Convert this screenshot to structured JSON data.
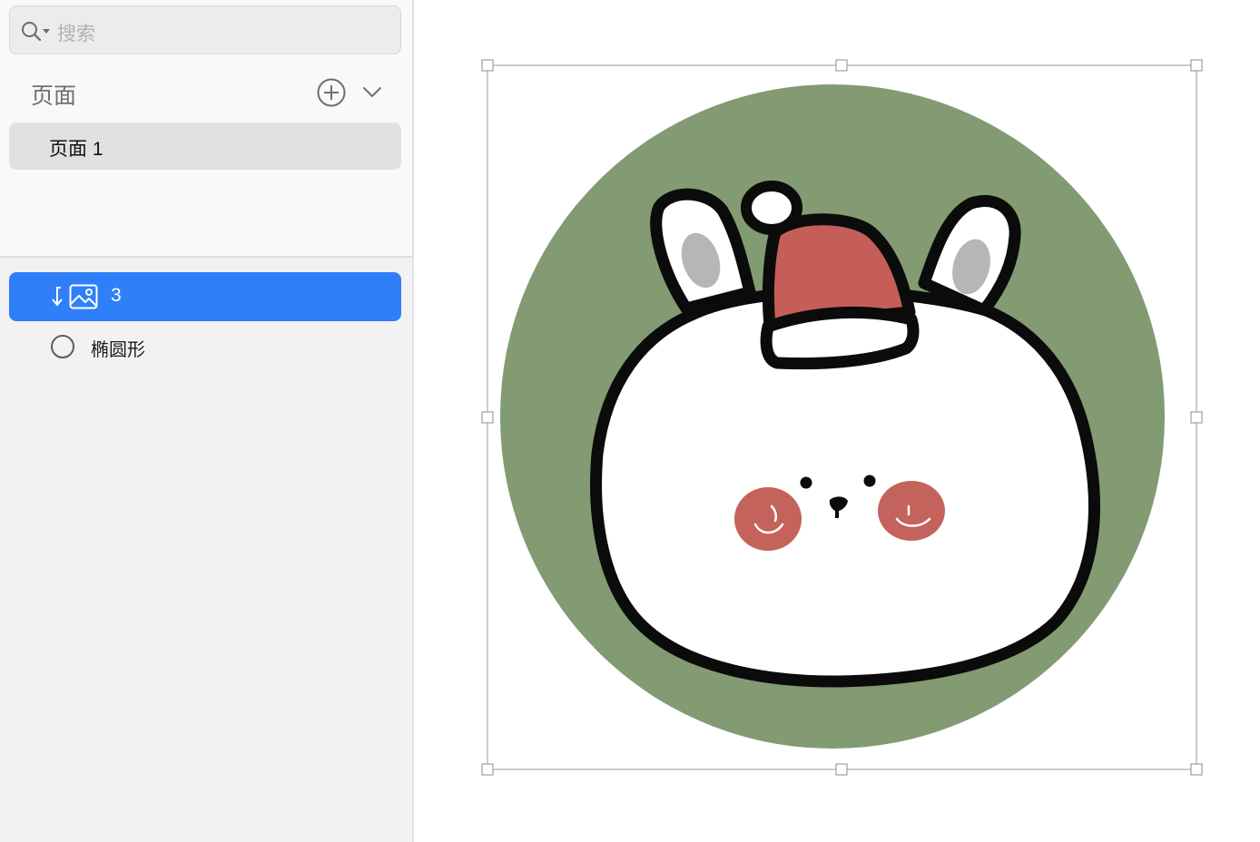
{
  "sidebar": {
    "search": {
      "placeholder": "搜索"
    },
    "pages": {
      "header": "页面",
      "items": [
        {
          "label": "页面 1"
        }
      ]
    },
    "layers": [
      {
        "label": "3",
        "kind": "image",
        "icon": "image-icon",
        "selected": true
      },
      {
        "label": "椭圆形",
        "kind": "ellipse",
        "icon": "ellipse-icon",
        "selected": false
      }
    ]
  },
  "canvas": {
    "artwork": {
      "subject": "bunny-with-santa-hat",
      "colors": {
        "background_circle": "#829b72",
        "face": "#ffffff",
        "outline": "#0b0b0b",
        "hat": "#c55e58",
        "cheeks": "#c4625c",
        "inner_ear": "#b6b6b8"
      }
    },
    "selection_handle_color": "#9a9a9a"
  },
  "colors": {
    "accent": "#2f7ff8",
    "sidebar_bg": "#f2f2f2",
    "pages_bg": "#f9f9f9",
    "selected_page_bg": "#e1e1e1"
  }
}
